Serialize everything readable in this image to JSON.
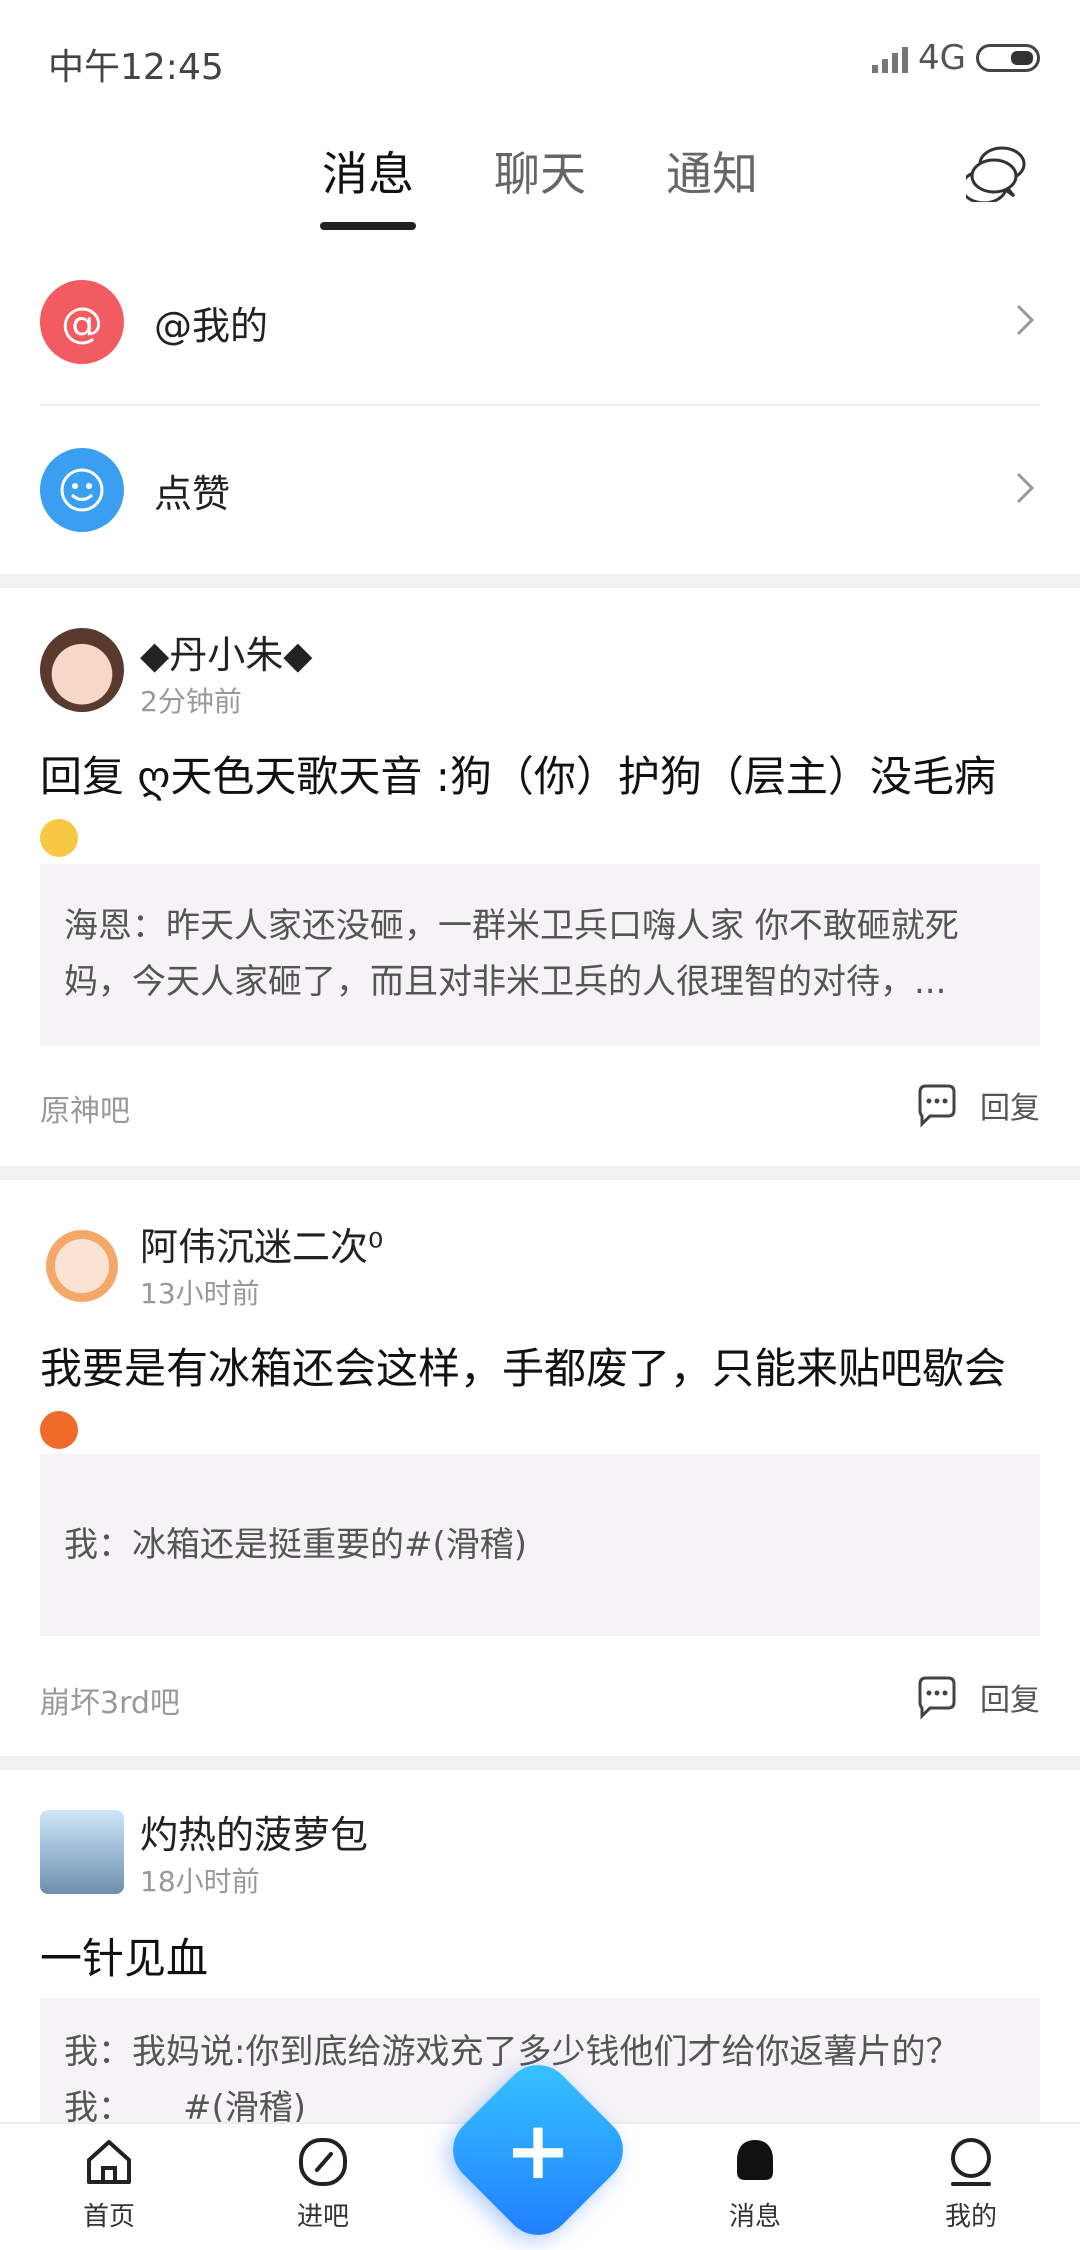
{
  "status": {
    "time": "中午12:45",
    "network": "4G"
  },
  "tabs": {
    "messages": "消息",
    "chat": "聊天",
    "notice": "通知"
  },
  "top_rows": [
    {
      "label": "@我的"
    },
    {
      "label": "点赞"
    }
  ],
  "posts": [
    {
      "username": "◆丹小朱◆",
      "time": "2分钟前",
      "content": "回复 ღ天色天歌天音 :狗（你）护狗（层主）没毛病",
      "quote": "海恩：昨天人家还没砸，一群米卫兵口嗨人家 你不敢砸就死妈，今天人家砸了，而且对非米卫兵的人很理智的对待，...",
      "forum": "原神吧",
      "reply": "回复"
    },
    {
      "username": "阿伟沉迷二次⁰",
      "time": "13小时前",
      "content": "我要是有冰箱还会这样，手都废了，只能来贴吧歇会",
      "quote": "我：冰箱还是挺重要的#(滑稽)",
      "forum": "崩坏3rd吧",
      "reply": "回复"
    },
    {
      "username": "灼热的菠萝包",
      "time": "18小时前",
      "content": "一针见血",
      "quote": "我：我妈说:你到底给游戏充了多少钱他们才给你返薯片的？",
      "quote2": "我：　　#(滑稽)"
    }
  ],
  "bottom_nav": {
    "home": "首页",
    "enter": "进吧",
    "messages": "消息",
    "me": "我的"
  }
}
